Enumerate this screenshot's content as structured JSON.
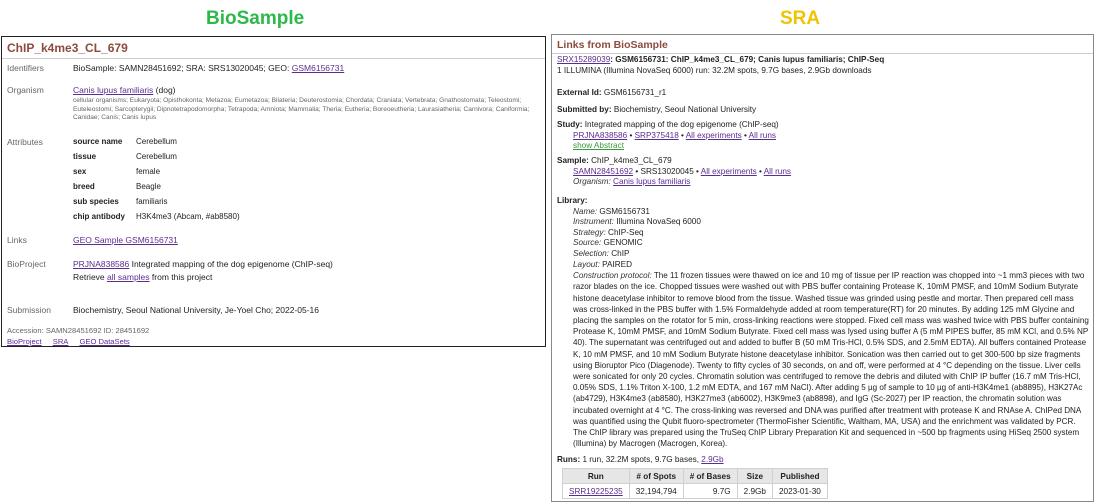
{
  "titles": {
    "biosample": "BioSample",
    "sra": "SRA"
  },
  "colors": {
    "biosample_title": "#2db84a",
    "sra_title": "#f2c300",
    "header": "#8c4b3c",
    "link": "#5b2c91"
  },
  "biosample": {
    "header": "ChIP_k4me3_CL_679",
    "identifiers_label": "Identifiers",
    "identifiers_text": "BioSample: SAMN28451692; SRA: SRS13020045; GEO: ",
    "identifiers_geo": "GSM6156731",
    "organism_label": "Organism",
    "organism_link": "Canis lupus familiaris",
    "organism_common": " (dog)",
    "lineage": "cellular organisms; Eukaryota; Opisthokonta; Metazoa; Eumetazoa; Bilateria; Deuterostomia; Chordata; Craniata; Vertebrata; Gnathostomata; Teleostomi; Euteleostomi; Sarcopterygii; Dipnotetrapodomorpha; Tetrapoda; Amniota; Mammalia; Theria; Eutheria; Boreoeutheria; Laurasiatheria; Carnivora; Caniformia; Canidae; Canis; Canis lupus",
    "attributes_label": "Attributes",
    "attributes": [
      {
        "key": "source name",
        "value": "Cerebellum"
      },
      {
        "key": "tissue",
        "value": "Cerebellum"
      },
      {
        "key": "sex",
        "value": "female"
      },
      {
        "key": "breed",
        "value": "Beagle"
      },
      {
        "key": "sub species",
        "value": "familiaris"
      },
      {
        "key": "chip antibody",
        "value": "H3K4me3 (Abcam, #ab8580)"
      }
    ],
    "links_label": "Links",
    "links_value": "GEO Sample GSM6156731",
    "bioproject_label": "BioProject",
    "bioproject_link": "PRJNA838586",
    "bioproject_text": " Integrated mapping of the dog epigenome (ChIP-seq)",
    "retrieve_prefix": "Retrieve ",
    "retrieve_link": "all samples",
    "retrieve_suffix": " from this project",
    "submission_label": "Submission",
    "submission_value": "Biochemistry, Seoul National University, Je-Yoel Cho; 2022-05-16",
    "accession_line": "Accession: SAMN28451692   ID: 28451692",
    "footer_links": [
      "BioProject",
      "SRA",
      "GEO DataSets"
    ]
  },
  "sra": {
    "header": "Links from BioSample",
    "srx_link": "SRX15289039",
    "srx_title": ": GSM6156731: ChIP_k4me3_CL_679; Canis lupus familiaris; ChIP-Seq",
    "run_summary": "1 ILLUMINA (Illumina NovaSeq 6000) run: 32.2M spots, 9.7G bases, 2.9Gb downloads",
    "external_id_label": "External Id:",
    "external_id_value": " GSM6156731_r1",
    "submitted_label": "Submitted by:",
    "submitted_value": " Biochemistry, Seoul National University",
    "study_label": "Study:",
    "study_value": " Integrated mapping of the dog epigenome (ChIP-seq)",
    "study_links": [
      "PRJNA838586",
      "SRP375418",
      "All experiments",
      "All runs"
    ],
    "show_abstract": "show Abstract",
    "sample_label": "Sample:",
    "sample_value": " ChIP_k4me3_CL_679",
    "sample_link1": "SAMN28451692",
    "sample_plain": " • SRS13020045 • ",
    "sample_links2": [
      "All experiments",
      "All runs"
    ],
    "organism_label": "Organism:",
    "organism_link": "Canis lupus familiaris",
    "library_label": "Library:",
    "library_fields": [
      {
        "key": "Name:",
        "value": " GSM6156731"
      },
      {
        "key": "Instrument:",
        "value": " Illumina NovaSeq 6000"
      },
      {
        "key": "Strategy:",
        "value": " ChIP-Seq"
      },
      {
        "key": "Source:",
        "value": " GENOMIC"
      },
      {
        "key": "Selection:",
        "value": " ChIP"
      },
      {
        "key": "Layout:",
        "value": " PAIRED"
      }
    ],
    "protocol_label": "Construction protocol:",
    "protocol_text": " The 11 frozen tissues were thawed on ice and 10 mg of tissue per IP reaction was chopped into ~1 mm3 pieces with two razor blades on the ice. Chopped tissues were washed out with PBS buffer containing Protease K, 10mM PMSF, and 10mM Sodium Butyrate histone deacetylase inhibitor to remove blood from the tissue. Washed tissue was grinded using pestle and mortar. Then prepared cell mass was cross-linked in the PBS buffer with 1.5% Formaldehyde added at room temperature(RT) for 20 minutes. By adding 125 mM Glycine and placing the samples on the rotator for 5 min, cross-linking reactions were stopped. Fixed cell mass was washed twice with PBS buffer containing Protease K, 10mM PMSF, and 10mM Sodium Butyrate. Fixed cell mass was lysed using buffer A (5 mM PIPES buffer, 85 mM KCl, and 0.5% NP 40). The supernatant was centrifuged out and added to buffer B (50 mM Tris-HCl, 0.5% SDS, and 2.5mM EDTA). All buffers contained Protease K, 10 mM PMSF, and 10 mM Sodium Butyrate histone deacetylase inhibitor. Sonication was then carried out to get 300-500 bp size fragments using Bioruptor Pico (Diagenode). Twenty to fifty cycles of 30 seconds, on and off, were performed at 4 °C depending on the tissue. Liver cells were sonicated for only 20 cycles. Chromatin solution was centrifuged to remove the debris and diluted with ChIP IP buffer (16.7 mM Tris-HCl, 0.05% SDS, 1.1% Triton X-100, 1.2 mM EDTA, and 167 mM NaCl). After adding 5 µg of sample to 10 µg of anti-H3K4me1 (ab8895), H3K27Ac (ab4729), H3K4me3 (ab8580), H3K27me3 (ab6002), H3K9me3 (ab8898), and IgG (Sc-2027) per IP reaction, the chromatin solution was incubated overnight at 4 °C. The cross-linking was reversed and DNA was purified after treatment with protease K and RNAse A. ChIPed DNA was quantified using the Qubit fluoro-spectrometer (ThermoFisher Scientific, Waltham, MA, USA) and the enrichment was validated by PCR. The ChIP library was prepared using the TruSeq ChIP Library Preparation Kit and sequenced in ~500 bp fragments using HiSeq 2500 system (Illumina) by Macrogen (Macrogen, Korea).",
    "runs_label": "Runs:",
    "runs_text": " 1 run, 32.2M spots, 9.7G bases, ",
    "runs_link": "2.9Gb",
    "runs_table": {
      "headers": [
        "Run",
        "# of Spots",
        "# of Bases",
        "Size",
        "Published"
      ],
      "rows": [
        [
          "SRR19225235",
          "32,194,794",
          "9.7G",
          "2.9Gb",
          "2023-01-30"
        ]
      ]
    }
  }
}
